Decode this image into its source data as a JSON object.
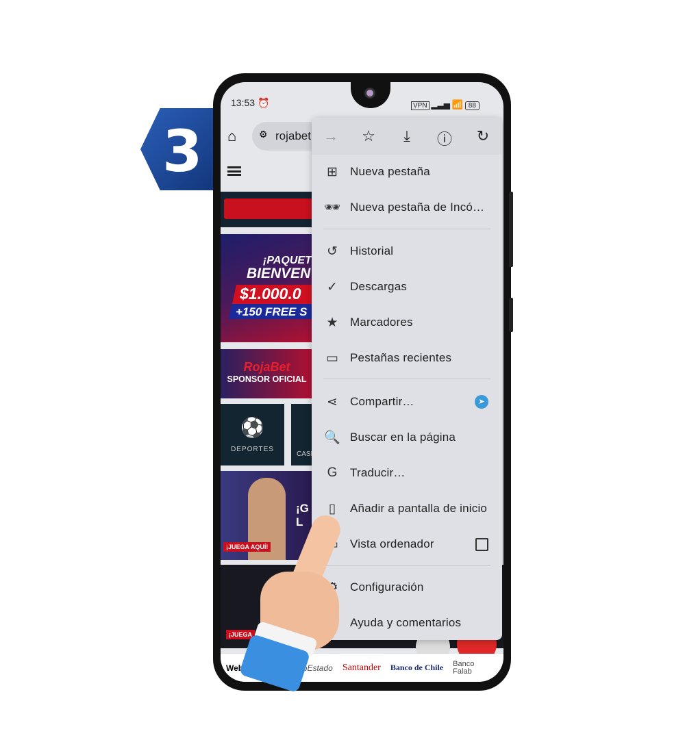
{
  "step_badge": "3",
  "status_bar": {
    "time": "13:53",
    "vpn": "VPN",
    "battery": "88"
  },
  "browser": {
    "url": "rojabet"
  },
  "menu": {
    "toolbar": [
      "forward-icon",
      "star-icon",
      "download-icon",
      "info-icon",
      "reload-icon"
    ],
    "items": [
      {
        "label": "Nueva pestaña",
        "icon": "plus-box-icon"
      },
      {
        "label": "Nueva pestaña de Incó…",
        "icon": "incognito-icon"
      },
      {
        "label": "Historial",
        "icon": "history-icon"
      },
      {
        "label": "Descargas",
        "icon": "downloads-icon"
      },
      {
        "label": "Marcadores",
        "icon": "star-icon"
      },
      {
        "label": "Pestañas recientes",
        "icon": "devices-icon"
      },
      {
        "label": "Compartir…",
        "icon": "share-icon"
      },
      {
        "label": "Buscar en la página",
        "icon": "find-icon"
      },
      {
        "label": "Traducir…",
        "icon": "translate-icon"
      },
      {
        "label": "Añadir a pantalla de inicio",
        "icon": "add-home-icon"
      },
      {
        "label": "Vista ordenador",
        "icon": "desktop-icon"
      },
      {
        "label": "Configuración",
        "icon": "gear-icon"
      },
      {
        "label": "Ayuda y comentarios",
        "icon": "help-icon"
      }
    ]
  },
  "page": {
    "banner": {
      "line1": "¡PAQUET",
      "line2": "BIENVEN",
      "amount": "$1.000.0",
      "free": "+150 FREE S"
    },
    "sponsor": {
      "brand": "RojaBet",
      "text": "SPONSOR OFICIAL"
    },
    "tiles": [
      "DEPORTES",
      "CASI"
    ],
    "promo": {
      "line": "¡G L",
      "cta": "¡JUEGA AQUÍ!"
    },
    "promo2": {
      "cta": "¡JUEGA"
    },
    "banks": [
      "Web",
      "ncoEstado",
      "Santander",
      "Banco de Chile",
      "Banco Falab"
    ]
  },
  "colors": {
    "badge": "#1f4a9e",
    "red": "#c8101e",
    "navy": "#1a2550"
  }
}
